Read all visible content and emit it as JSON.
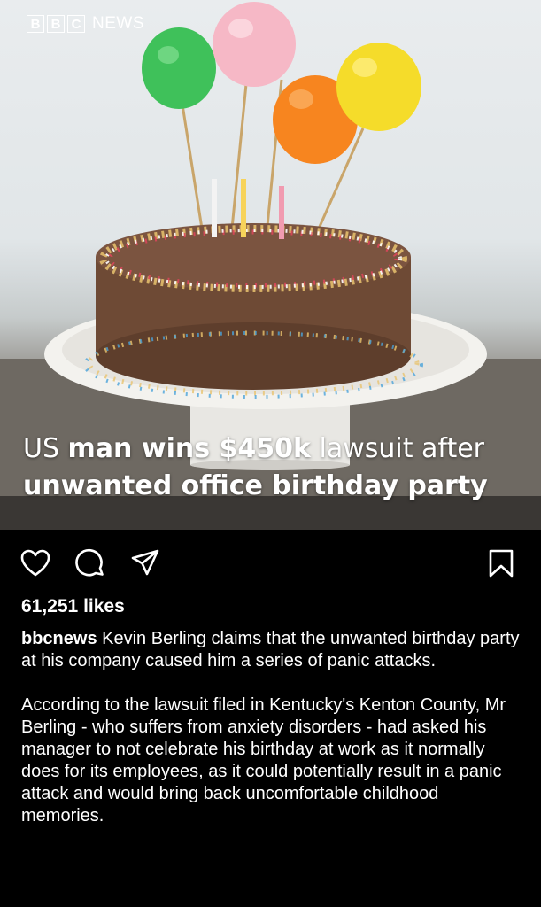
{
  "image": {
    "brand_blocks": [
      "B",
      "B",
      "C"
    ],
    "brand_text": "NEWS",
    "headline": [
      {
        "text": "US ",
        "bold": false
      },
      {
        "text": "man wins $450k",
        "bold": true
      },
      {
        "text": " lawsuit after ",
        "bold": false
      },
      {
        "text": "unwanted office birthday party",
        "bold": true
      }
    ]
  },
  "actions": {
    "like_icon": "heart-icon",
    "comment_icon": "comment-icon",
    "share_icon": "send-icon",
    "save_icon": "bookmark-icon"
  },
  "likes": "61,251 likes",
  "caption": {
    "username": "bbcnews",
    "text": "Kevin Berling claims that the unwanted birthday party at his company caused him a series of panic attacks.",
    "paragraph2": "According to the lawsuit filed in Kentucky's Kenton County, Mr Berling - who suffers from anxiety disorders - had asked his manager to not celebrate his birthday at work as it normally does for its employees, as it could potentially result in a panic attack and would bring back uncomfortable childhood memories."
  },
  "colors": {
    "background": "#000000",
    "text": "#ffffff",
    "balloon_green": "#3fc15a",
    "balloon_pink": "#f6b8c6",
    "balloon_orange": "#f7851f",
    "balloon_yellow": "#f5dc2a",
    "cake": "#6e4a35"
  }
}
